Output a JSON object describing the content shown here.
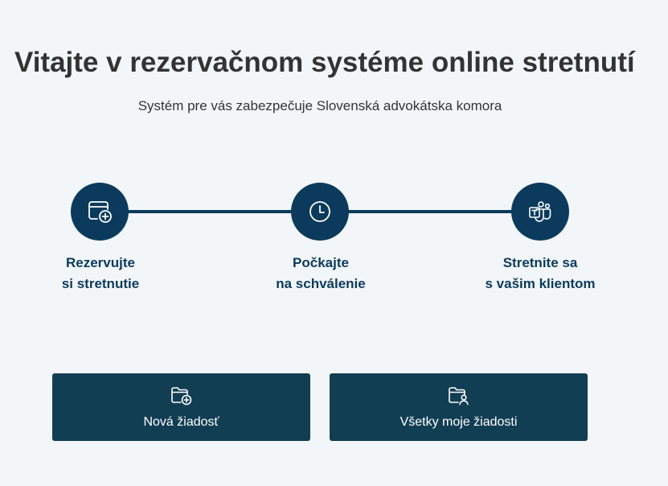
{
  "header": {
    "title": "Vitajte v rezervačnom systéme online stretnutí",
    "subtitle": "Systém pre vás zabezpečuje Slovenská advokátska komora"
  },
  "steps": [
    {
      "icon": "calendar-add-icon",
      "line1": "Rezervujte",
      "line2": "si stretnutie"
    },
    {
      "icon": "clock-icon",
      "line1": "Počkajte",
      "line2": "na schválenie"
    },
    {
      "icon": "teams-icon",
      "line1": "Stretnite sa",
      "line2": "s vašim klientom"
    }
  ],
  "actions": {
    "new_request": {
      "icon": "folder-add-icon",
      "label": "Nová žiadosť"
    },
    "all_requests": {
      "icon": "folder-person-icon",
      "label": "Všetky moje žiadosti"
    }
  },
  "colors": {
    "background": "#f2f6f9",
    "accent": "#0b3a5c",
    "button": "#123e54",
    "text": "#333333"
  }
}
